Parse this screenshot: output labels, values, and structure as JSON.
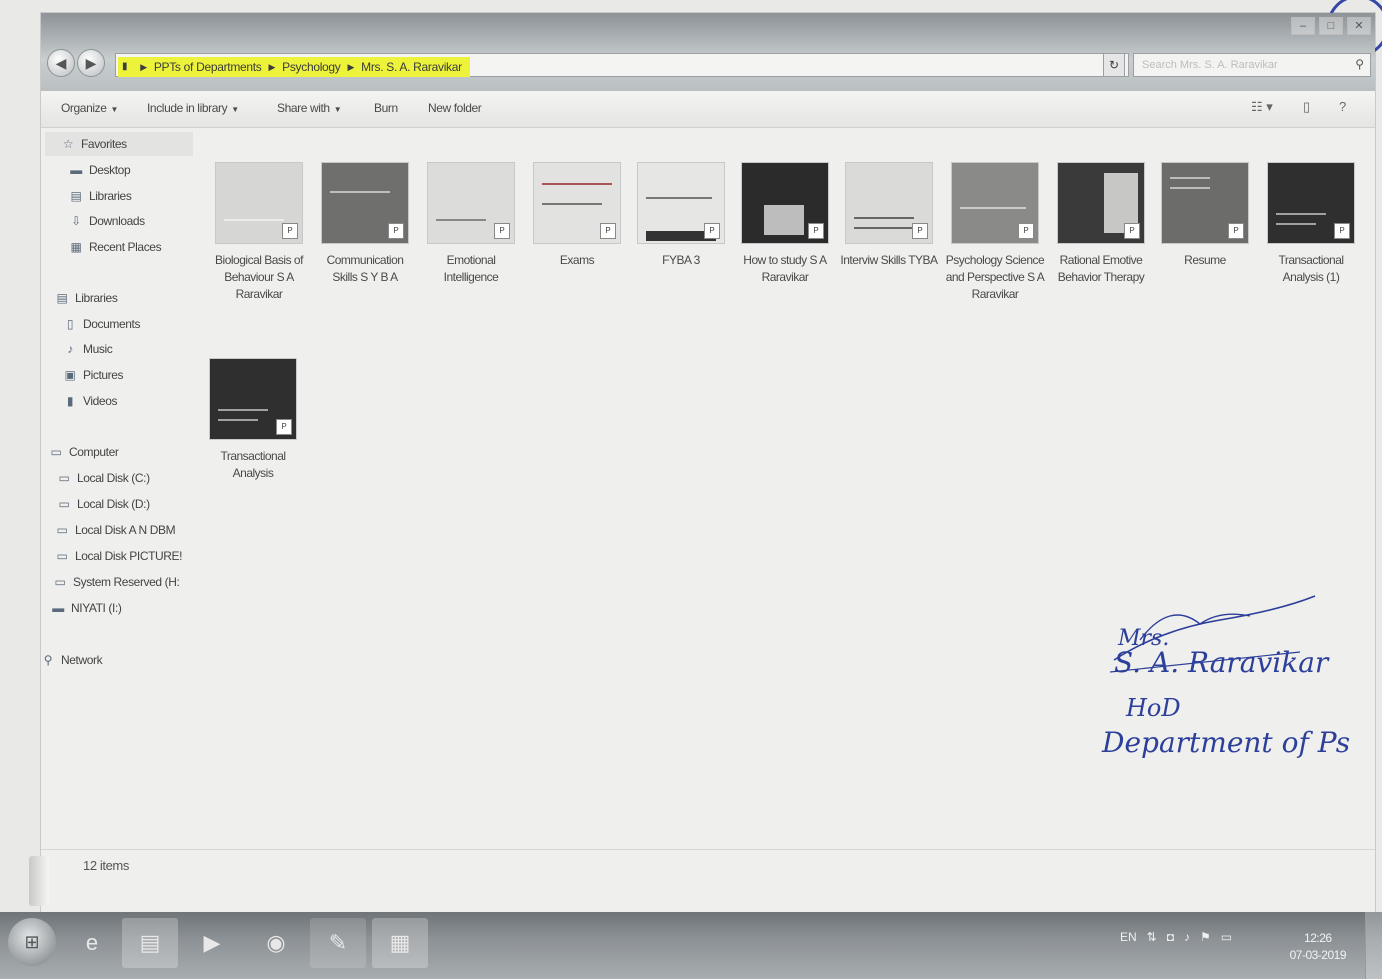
{
  "address_bar": {
    "breadcrumbs": [
      "PPTs of Departments",
      "Psychology",
      "Mrs. S. A. Raravikar"
    ]
  },
  "search": {
    "placeholder": "Search Mrs. S. A. Raravikar"
  },
  "toolbar": {
    "organize": "Organize",
    "include_in_library": "Include in library",
    "share_with": "Share with",
    "burn": "Burn",
    "new_folder": "New folder"
  },
  "sidebar": {
    "favorites": "Favorites",
    "fav_items": [
      "Desktop",
      "Libraries",
      "Downloads",
      "Recent Places"
    ],
    "libraries": "Libraries",
    "lib_items": [
      "Documents",
      "Music",
      "Pictures",
      "Videos"
    ],
    "computer": "Computer",
    "comp_items": [
      "Local Disk (C:)",
      "Local Disk (D:)",
      "Local Disk  A N DBM",
      "Local Disk PICTURE!",
      "System Reserved (H:",
      "NIYATI (I:)"
    ],
    "network": "Network"
  },
  "files": [
    {
      "label": "Biological Basis of Behaviour S A Raravikar",
      "thumb_color": "#d6d6d4"
    },
    {
      "label": "Communication Skills S Y B A",
      "thumb_color": "#6f6f6d"
    },
    {
      "label": "Emotional Intelligence",
      "thumb_color": "#dcdcda"
    },
    {
      "label": "Exams",
      "thumb_color": "#e2e2e0"
    },
    {
      "label": "FYBA 3",
      "thumb_color": "#e6e6e4"
    },
    {
      "label": "How to study S A Raravikar",
      "thumb_color": "#2b2b2b"
    },
    {
      "label": "Interviw Skills TYBA",
      "thumb_color": "#dadad8"
    },
    {
      "label": "Psychology Science and Perspective S A Raravikar",
      "thumb_color": "#8a8a88"
    },
    {
      "label": "Rational Emotive Behavior Therapy",
      "thumb_color": "#3a3a3a"
    },
    {
      "label": "Resume",
      "thumb_color": "#6c6c6a"
    },
    {
      "label": "Transactional Analysis (1)",
      "thumb_color": "#2f2f2f"
    },
    {
      "label": "Transactional Analysis",
      "thumb_color": "#2f2f2f"
    }
  ],
  "status": {
    "item_count": "12 items"
  },
  "taskbar": {
    "language": "EN",
    "time": "12:26",
    "date": "07-03-2019"
  },
  "handwriting": {
    "signature": "Mrs.",
    "name": "S. A. Raravikar",
    "role": "HoD",
    "department": "Department of Ps"
  },
  "colors": {
    "breadcrumb_highlight": "#ecf33a",
    "handwriting_ink": "#2c3f9a"
  }
}
